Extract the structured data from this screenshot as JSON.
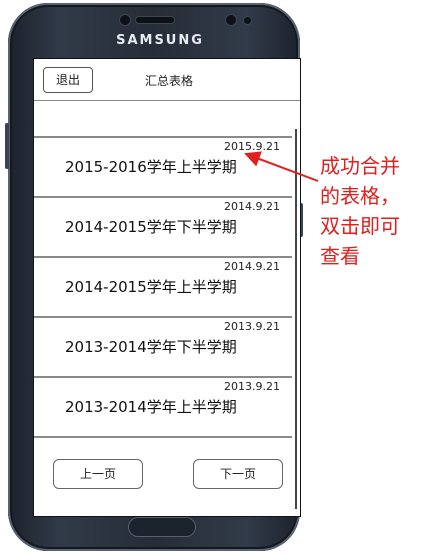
{
  "device": {
    "brand": "SAMSUNG"
  },
  "header": {
    "back_label": "退出",
    "title": "汇总表格"
  },
  "semesters": [
    {
      "date": "2015.9.21",
      "name": "2015-2016学年上半学期"
    },
    {
      "date": "2014.9.21",
      "name": "2014-2015学年下半学期"
    },
    {
      "date": "2014.9.21",
      "name": "2014-2015学年上半学期"
    },
    {
      "date": "2013.9.21",
      "name": "2013-2014学年下半学期"
    },
    {
      "date": "2013.9.21",
      "name": "2013-2014学年上半学期"
    }
  ],
  "pagination": {
    "prev_label": "上一页",
    "next_label": "下一页"
  },
  "annotation": {
    "lines": [
      "成功合并",
      "的表格，",
      "双击即可",
      "查看"
    ],
    "color": "#e0201f"
  }
}
